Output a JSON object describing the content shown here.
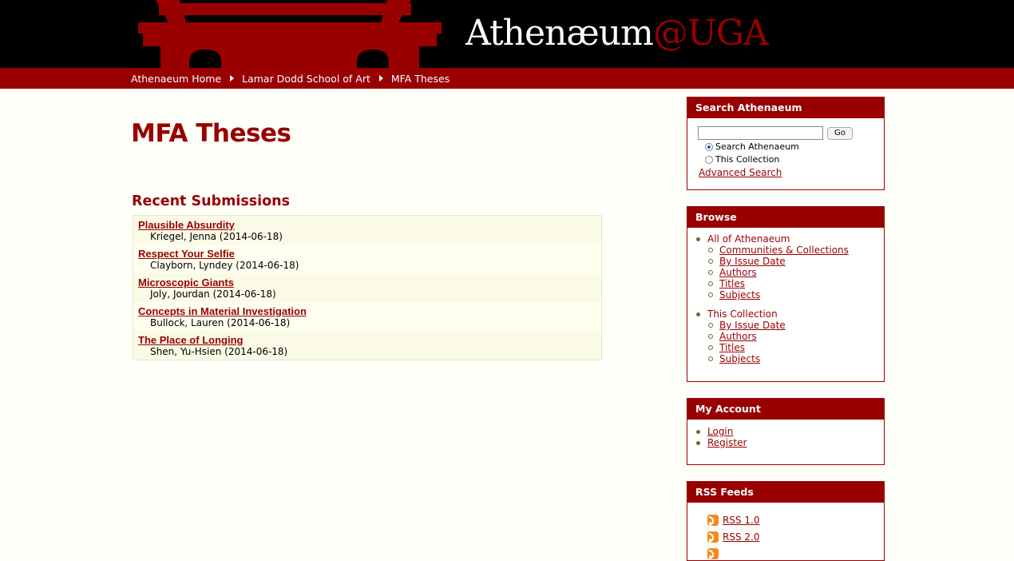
{
  "header": {
    "title_part1": "Athenæum",
    "title_part2": "@UGA",
    "logo_icon": "arch-columns-logo"
  },
  "breadcrumb": [
    "Athenaeum Home",
    "Lamar Dodd School of Art",
    "MFA Theses"
  ],
  "page_title": "MFA Theses",
  "recent": {
    "heading": "Recent Submissions",
    "items": [
      {
        "title": "Plausible Absurdity",
        "meta": "Kriegel, Jenna (2014-06-18)"
      },
      {
        "title": "Respect Your Selfie",
        "meta": "Clayborn, Lyndey (2014-06-18)"
      },
      {
        "title": "Microscopic Giants",
        "meta": "Joly, Jourdan (2014-06-18)"
      },
      {
        "title": "Concepts in Material Investigation",
        "meta": "Bullock, Lauren (2014-06-18)"
      },
      {
        "title": "The Place of Longing",
        "meta": "Shen, Yu-Hsien (2014-06-18)"
      }
    ]
  },
  "search": {
    "heading": "Search Athenaeum",
    "input_value": "",
    "go_label": "Go",
    "scope_all": "Search Athenaeum",
    "scope_collection": "This Collection",
    "selected_scope": "Search Athenaeum",
    "advanced": "Advanced Search"
  },
  "browse": {
    "heading": "Browse",
    "all_label": "All of Athenaeum",
    "all_items": [
      "Communities & Collections",
      "By Issue Date",
      "Authors",
      "Titles",
      "Subjects"
    ],
    "collection_label": "This Collection",
    "collection_items": [
      "By Issue Date",
      "Authors",
      "Titles",
      "Subjects"
    ]
  },
  "account": {
    "heading": "My Account",
    "login": "Login",
    "register": "Register"
  },
  "rss": {
    "heading": "RSS Feeds",
    "rss1": "RSS 1.0",
    "rss2": "RSS 2.0"
  },
  "colors": {
    "brand_red": "#990000",
    "header_black": "#000000"
  }
}
